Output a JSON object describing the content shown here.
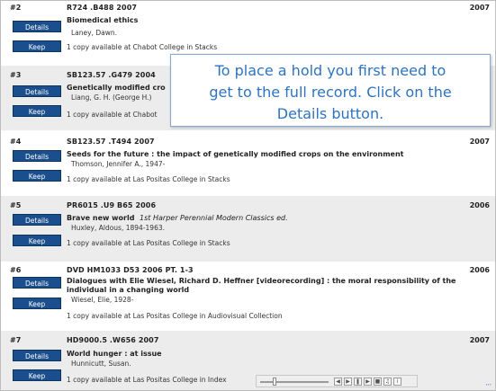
{
  "records": [
    {
      "num": "#2",
      "call": "R724 .B488 2007",
      "year": "2007",
      "title": "Biomedical ethics",
      "edition": "",
      "author": "Laney, Dawn.",
      "availability": "1 copy available at Chabot College in Stacks",
      "details_label": "Details",
      "keep_label": "Keep"
    },
    {
      "num": "#3",
      "call": "SB123.57 .G479 2004",
      "year": "",
      "title": "Genetically modified cro",
      "edition": "",
      "author": "Liang, G. H. (George H.)",
      "availability": "1 copy available at Chabot",
      "details_label": "Details",
      "keep_label": "Keep"
    },
    {
      "num": "#4",
      "call": "SB123.57 .T494 2007",
      "year": "2007",
      "title": "Seeds for the future : the impact of genetically modified crops on the environment",
      "edition": "",
      "author": "Thomson, Jennifer A., 1947-",
      "availability": "1 copy available at Las Positas College in Stacks",
      "details_label": "Details",
      "keep_label": "Keep"
    },
    {
      "num": "#5",
      "call": "PR6015 .U9 B65 2006",
      "year": "2006",
      "title": "Brave new world",
      "edition": "1st Harper Perennial Modern Classics ed.",
      "author": "Huxley, Aldous, 1894-1963.",
      "availability": "1 copy available at Las Positas College in Stacks",
      "details_label": "Details",
      "keep_label": "Keep"
    },
    {
      "num": "#6",
      "call": "DVD HM1033 D53 2006 PT. 1-3",
      "year": "2006",
      "title": "Dialogues with Elie Wiesel, Richard D. Heffner [videorecording] : the moral responsibility of the individual in a changing world",
      "edition": "",
      "author": "Wiesel, Elie, 1928-",
      "availability": "1 copy available at Las Positas College in Audiovisual Collection",
      "details_label": "Details",
      "keep_label": "Keep"
    },
    {
      "num": "#7",
      "call": "HD9000.5 .W656 2007",
      "year": "2007",
      "title": "World hunger : at issue",
      "edition": "",
      "author": "Hunnicutt, Susan.",
      "availability": "1 copy available at Las Positas College in Index",
      "details_label": "Details",
      "keep_label": "Keep"
    }
  ],
  "callout": {
    "line1": "To place a hold you first need to",
    "line2": "get to the full record.  Click on the",
    "line3": "Details button."
  },
  "player": {
    "rewind_icon": "rewind-icon",
    "play_icon": "play-icon",
    "pause_icon": "pause-icon",
    "forward_icon": "forward-icon",
    "info_icon": "info-icon"
  },
  "corner_text": "’’’"
}
